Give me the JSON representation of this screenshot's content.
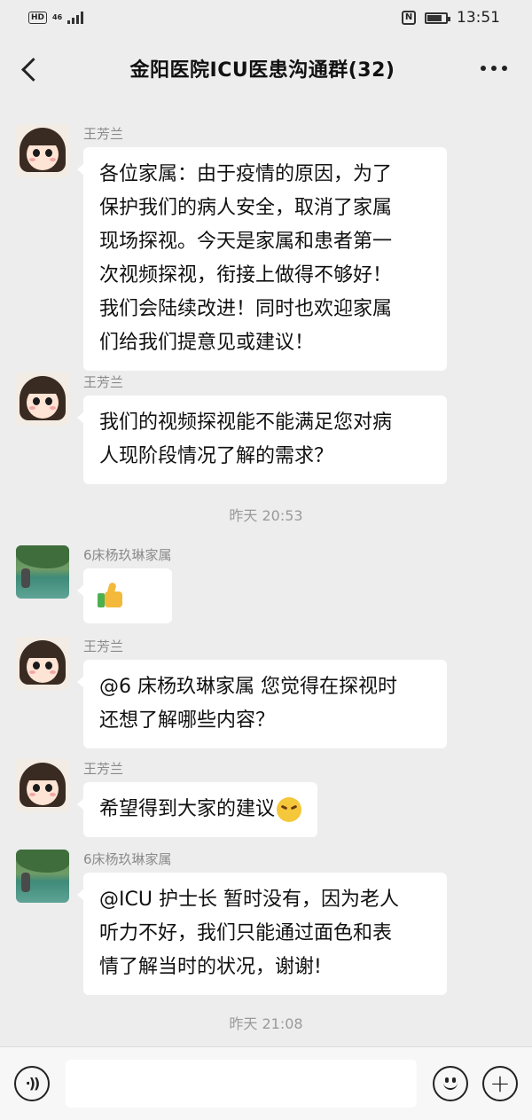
{
  "status_bar": {
    "hd": "HD",
    "network": "46",
    "nfc": "N",
    "battery_level": 0.8,
    "time": "13:51"
  },
  "header": {
    "title": "金阳医院ICU医患沟通群(32)",
    "back_icon": "chevron-left-icon",
    "more_icon": "more-dots-icon"
  },
  "messages": [
    {
      "sender": "王芳兰",
      "avatar": "cartoon-girl",
      "lines": [
        "各位家属：由于疫情的原因，为了",
        "保护我们的病人安全，取消了家属",
        "现场探视。今天是家属和患者第一",
        "次视频探视，衔接上做得不够好！",
        "我们会陆续改进！同时也欢迎家属",
        "们给我们提意见或建议！"
      ]
    },
    {
      "sender": "王芳兰",
      "avatar": "cartoon-girl",
      "lines": [
        "我们的视频探视能不能满足您对病",
        "人现阶段情况了解的需求？"
      ]
    },
    {
      "sender": "6床杨玖琳家属",
      "avatar": "landscape",
      "emoji": "thumbs-up-icon"
    },
    {
      "sender": "王芳兰",
      "avatar": "cartoon-girl",
      "lines": [
        "@6 床杨玖琳家属  您觉得在探视时",
        "还想了解哪些内容？"
      ]
    },
    {
      "sender": "王芳兰",
      "avatar": "cartoon-girl",
      "lines": [
        "希望得到大家的建议"
      ],
      "trailing_emoji": "frown-face-icon"
    },
    {
      "sender": "6床杨玖琳家属",
      "avatar": "landscape",
      "lines": [
        "@ICU 护士长  暂时没有，因为老人",
        "听力不好，我们只能通过面色和表",
        "情了解当时的状况，谢谢!"
      ]
    }
  ],
  "timestamps": [
    "昨天 20:53",
    "昨天 21:08"
  ],
  "input_bar": {
    "voice_icon": "voice-icon",
    "placeholder": "",
    "emoji_icon": "smile-icon",
    "plus_icon": "plus-icon"
  }
}
